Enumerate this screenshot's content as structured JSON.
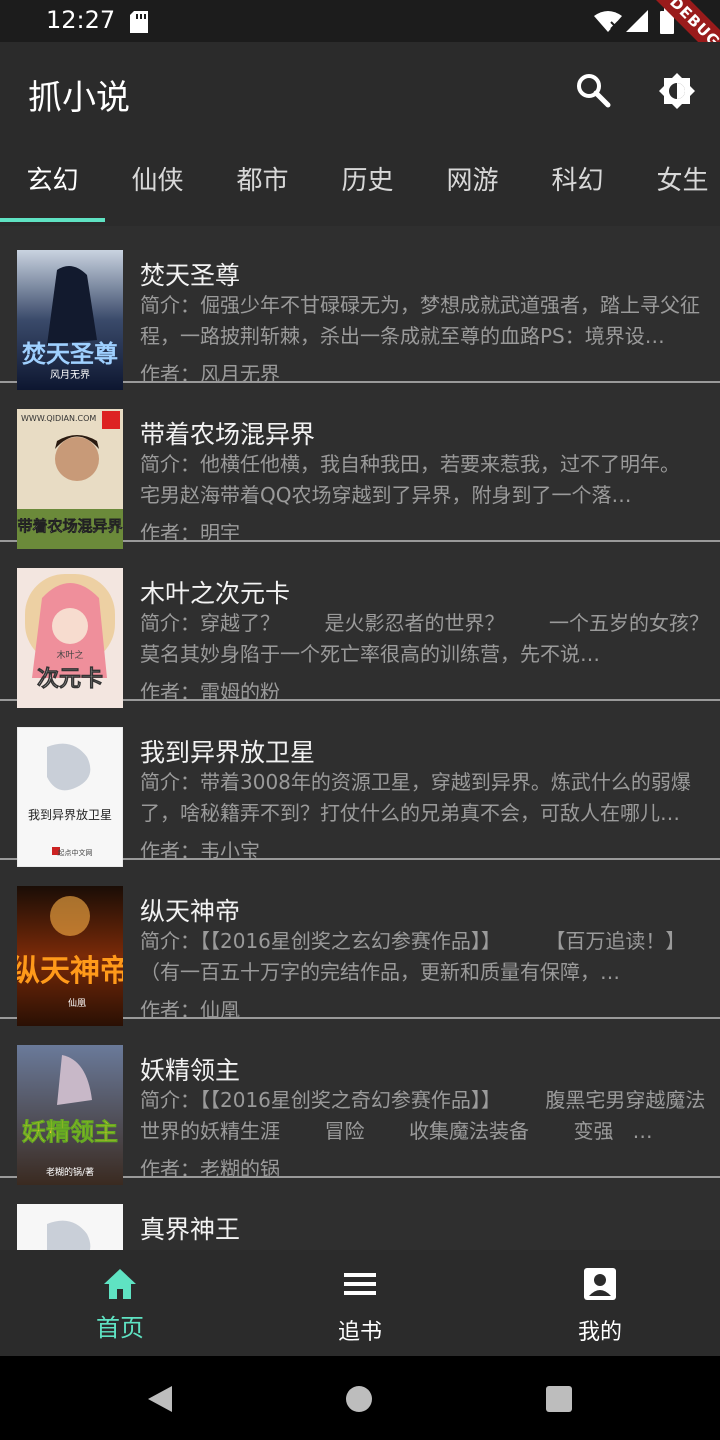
{
  "status_bar": {
    "time": "12:27",
    "debug_label": "DEBUG"
  },
  "app_bar": {
    "title": "抓小说"
  },
  "tabs": [
    {
      "label": "玄幻"
    },
    {
      "label": "仙侠"
    },
    {
      "label": "都市"
    },
    {
      "label": "历史"
    },
    {
      "label": "网游"
    },
    {
      "label": "科幻"
    },
    {
      "label": "女生"
    }
  ],
  "books": [
    {
      "title": "焚天圣尊",
      "intro": "简介：倔强少年不甘碌碌无为，梦想成就武道强者，踏上寻父征程，一路披荆斩棘，杀出一条成就至尊的血路PS：境界设…",
      "author": "作者：风月无界",
      "cover_text": "焚天圣尊",
      "cover_sub": "风月无界"
    },
    {
      "title": "带着农场混异界",
      "intro": "简介：他横任他横，我自种我田，若要来惹我，过不了明年。    宅男赵海带着QQ农场穿越到了异界，附身到了一个落…",
      "author": "作者：明宇",
      "cover_text": "带着农场混异界",
      "cover_sub": "WWW.QIDIAN.COM"
    },
    {
      "title": "木叶之次元卡",
      "intro": "简介：穿越了？       是火影忍者的世界？       一个五岁的女孩？       莫名其妙身陷于一个死亡率很高的训练营，先不说…",
      "author": "作者：雷姆的粉",
      "cover_text": "次元卡",
      "cover_sub": "木叶之"
    },
    {
      "title": "我到异界放卫星",
      "intro": "简介：带着3008年的资源卫星，穿越到异界。炼武什么的弱爆了，啥秘籍弄不到？打仗什么的兄弟真不会，可敌人在哪儿…",
      "author": "作者：韦小宝",
      "cover_text": "我到异界放卫星",
      "cover_sub": "起点中文网"
    },
    {
      "title": "纵天神帝",
      "intro": "简介：【【2016星创奖之玄幻参赛作品】】       【百万追读！】（有一百五十万字的完结作品，更新和质量有保障，…",
      "author": "作者：仙凰",
      "cover_text": "纵天神帝",
      "cover_sub": "仙凰"
    },
    {
      "title": "妖精领主",
      "intro": "简介：【【2016星创奖之奇幻参赛作品】】       腹黑宅男穿越魔法世界的妖精生涯       冒险       收集魔法装备       变强   …",
      "author": "作者：老糊的锅",
      "cover_text": "妖精领主",
      "cover_sub": "老糊的锅/著"
    },
    {
      "title": "真界神王",
      "intro": "",
      "author": "",
      "cover_text": "",
      "cover_sub": ""
    }
  ],
  "bottom_nav": [
    {
      "label": "首页",
      "icon": "home-icon"
    },
    {
      "label": "追书",
      "icon": "list-icon"
    },
    {
      "label": "我的",
      "icon": "account-icon"
    }
  ],
  "colors": {
    "accent": "#5fe3c3",
    "app_bar": "#2b2b2b",
    "list_bg": "#2f2f2f"
  }
}
